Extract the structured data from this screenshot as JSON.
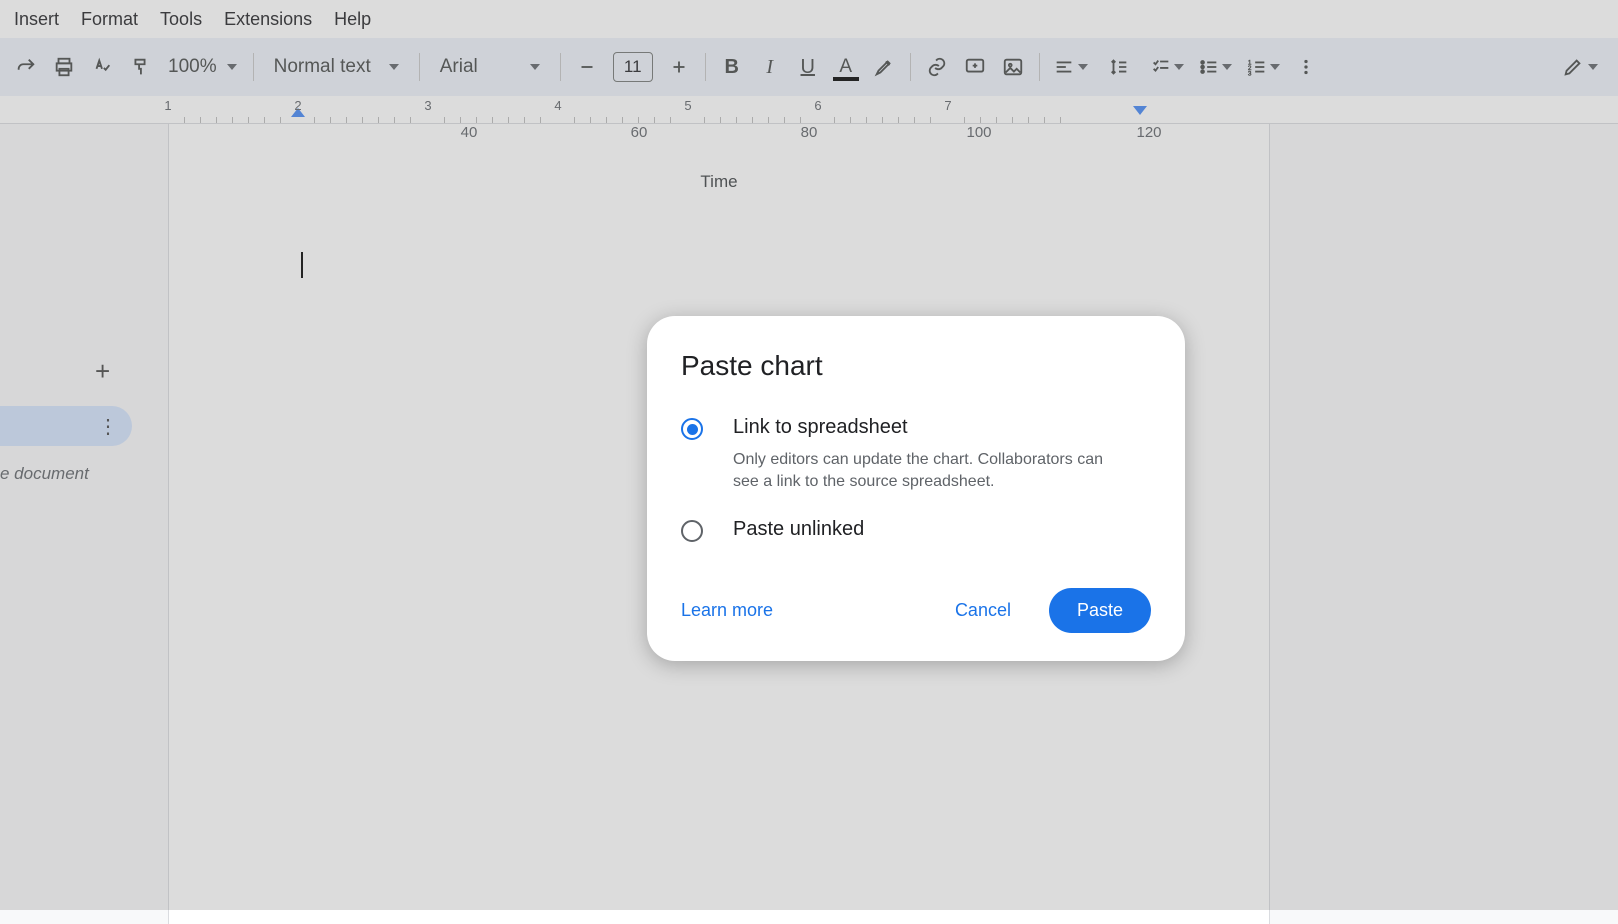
{
  "menubar": {
    "insert": "Insert",
    "format": "Format",
    "tools": "Tools",
    "extensions": "Extensions",
    "help": "Help"
  },
  "toolbar": {
    "zoom": "100%",
    "paragraph_style": "Normal text",
    "font": "Arial",
    "font_size": "11"
  },
  "ruler": {
    "numbers": [
      "1",
      "2",
      "3",
      "4",
      "5",
      "6",
      "7"
    ]
  },
  "chart_overlay": {
    "ticks": [
      "40",
      "60",
      "80",
      "100",
      "120"
    ],
    "title": "Time"
  },
  "sidebar": {
    "document_label": "e document"
  },
  "modal": {
    "title": "Paste chart",
    "option_link_label": "Link to spreadsheet",
    "option_link_desc": "Only editors can update the chart. Collaborators can see a link to the source spreadsheet.",
    "option_unlinked_label": "Paste unlinked",
    "learn_more": "Learn more",
    "cancel": "Cancel",
    "paste": "Paste"
  }
}
